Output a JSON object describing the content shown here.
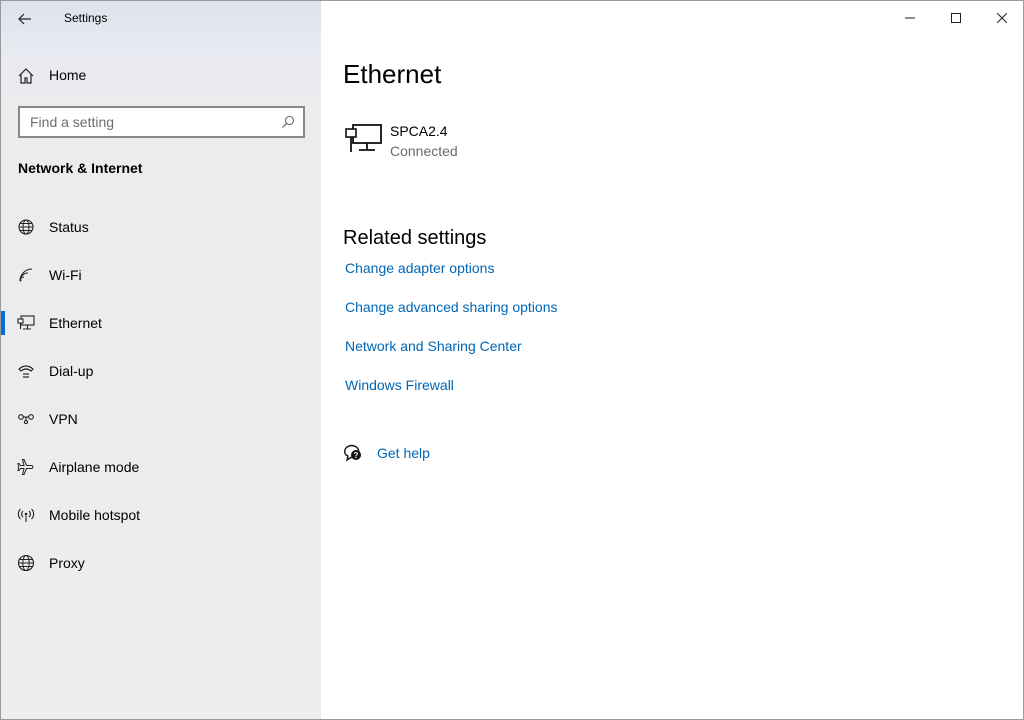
{
  "window": {
    "title": "Settings",
    "controls": [
      "minimize-icon",
      "maximize-icon",
      "close-icon"
    ]
  },
  "sidebar": {
    "home": {
      "label": "Home",
      "icon": "home-icon"
    },
    "search": {
      "placeholder": "Find a setting",
      "icon": "search-icon"
    },
    "section_title": "Network & Internet",
    "items": [
      {
        "label": "Status",
        "icon": "globe-status-icon"
      },
      {
        "label": "Wi-Fi",
        "icon": "wifi-icon"
      },
      {
        "label": "Ethernet",
        "icon": "ethernet-icon",
        "active": true
      },
      {
        "label": "Dial-up",
        "icon": "dialup-icon"
      },
      {
        "label": "VPN",
        "icon": "vpn-icon"
      },
      {
        "label": "Airplane mode",
        "icon": "airplane-icon"
      },
      {
        "label": "Mobile hotspot",
        "icon": "hotspot-icon"
      },
      {
        "label": "Proxy",
        "icon": "globe-icon"
      }
    ]
  },
  "main": {
    "title": "Ethernet",
    "connection": {
      "name": "SPCA2.4",
      "status": "Connected",
      "icon": "ethernet-monitor-icon"
    },
    "related": {
      "title": "Related settings",
      "links": [
        "Change adapter options",
        "Change advanced sharing options",
        "Network and Sharing Center",
        "Windows Firewall"
      ]
    },
    "help": {
      "label": "Get help",
      "icon": "help-chat-icon"
    }
  },
  "colors": {
    "accent": "#0a6ed1",
    "link": "#0066b4",
    "sidebar_bg": "#ededee"
  }
}
